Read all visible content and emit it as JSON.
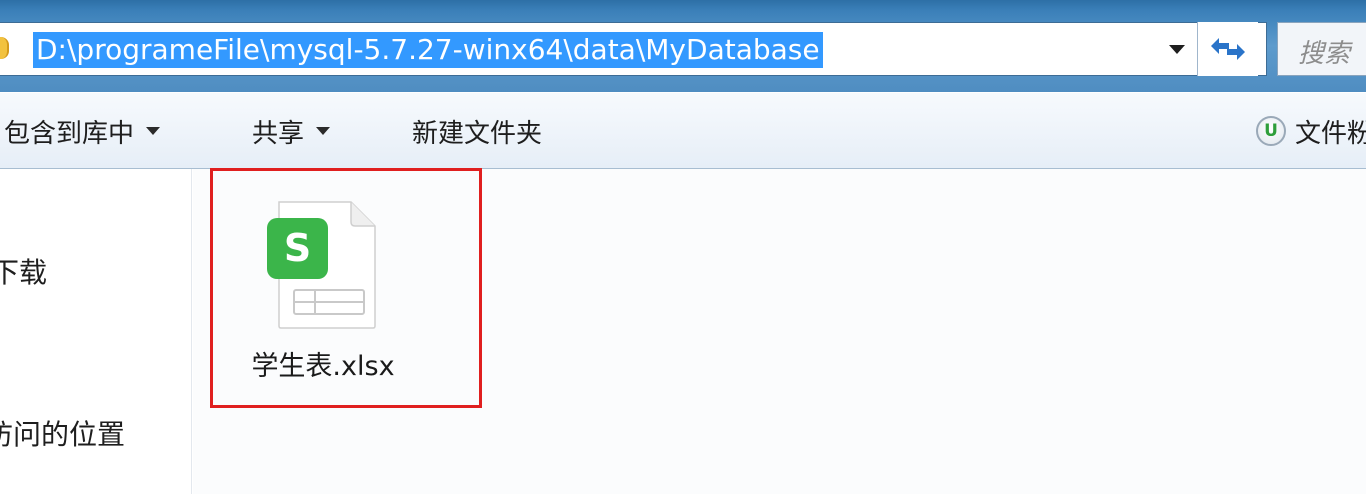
{
  "address_bar": {
    "path": "D:\\programeFile\\mysql-5.7.27-winx64\\data\\MyDatabase",
    "search_placeholder": "搜索"
  },
  "toolbar": {
    "include_in_library": "包含到库中",
    "share": "共享",
    "new_folder": "新建文件夹",
    "right_item": "文件粉",
    "right_item_icon_letter": "U"
  },
  "nav": {
    "items": [
      "下载",
      "访问的位置"
    ]
  },
  "files": [
    {
      "name": "学生表.xlsx",
      "icon": "wps-spreadsheet-icon",
      "icon_letter": "S"
    }
  ],
  "colors": {
    "selection_highlight": "#3399ff",
    "annotation_red": "#e01f1f",
    "wps_green": "#3bb54a"
  }
}
